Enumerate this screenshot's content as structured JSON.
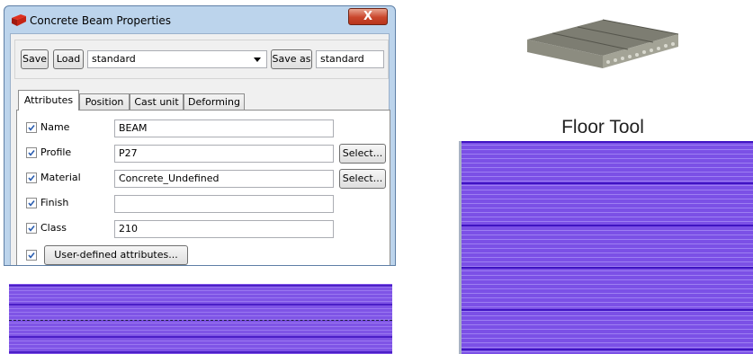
{
  "dialog": {
    "title": "Concrete Beam Properties",
    "close_glyph": "X",
    "toolbar": {
      "save_label": "Save",
      "load_label": "Load",
      "preset_value": "standard",
      "save_as_label": "Save as",
      "save_as_value": "standard"
    },
    "tabs": [
      {
        "label": "Attributes",
        "active": true
      },
      {
        "label": "Position",
        "active": false
      },
      {
        "label": "Cast unit",
        "active": false
      },
      {
        "label": "Deforming",
        "active": false
      }
    ],
    "attributes": [
      {
        "label": "Name",
        "value": "BEAM",
        "checked": true
      },
      {
        "label": "Profile",
        "value": "P27",
        "checked": true,
        "select_label": "Select..."
      },
      {
        "label": "Material",
        "value": "Concrete_Undefined",
        "checked": true,
        "select_label": "Select..."
      },
      {
        "label": "Finish",
        "value": "",
        "checked": true
      },
      {
        "label": "Class",
        "value": "210",
        "checked": true
      }
    ],
    "user_defined": {
      "checked": true,
      "label": "User-defined attributes..."
    }
  },
  "floor_tool": {
    "title": "Floor Tool"
  },
  "colors": {
    "title_bar": "#bcd4ec",
    "close_button": "#c9462c",
    "beam_fill": "#7f54e6",
    "beam_line": "#4b1fc7",
    "floor_fill": "#7b50e6",
    "floor_line": "#3f14c2",
    "checkbox_mark": "#2a5db0"
  }
}
